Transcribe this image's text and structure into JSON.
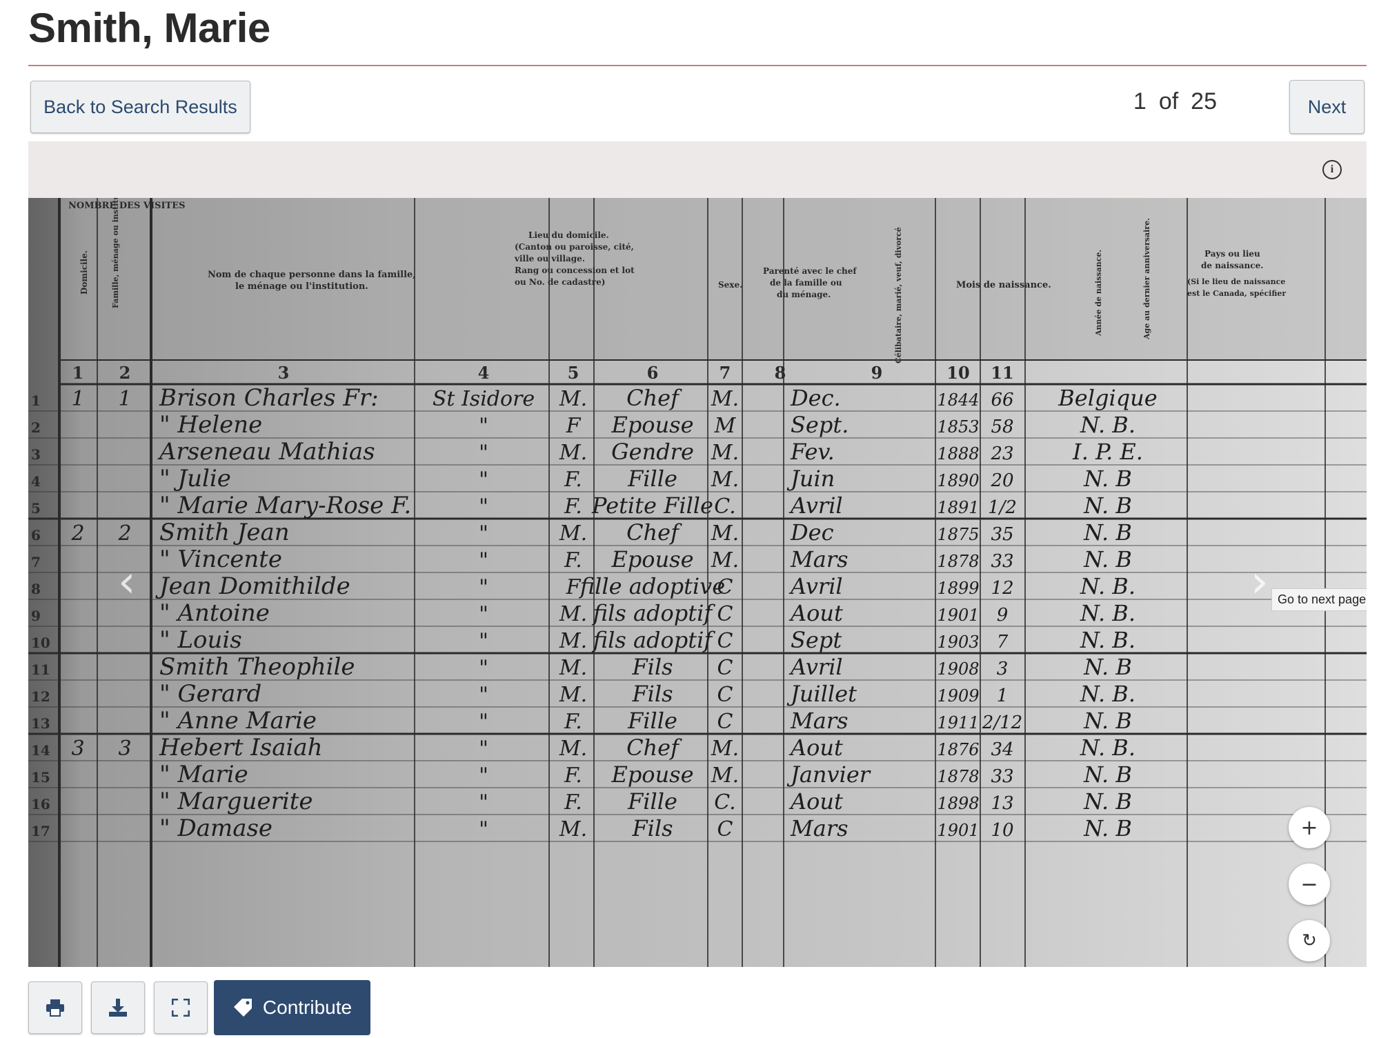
{
  "page": {
    "title": "Smith, Marie"
  },
  "nav": {
    "back_label": "Back to Search Results",
    "current": "1",
    "of_label": "of",
    "total": "25",
    "next_label": "Next"
  },
  "viewer": {
    "tooltip": "Go to next page",
    "zoom_in": "+",
    "zoom_out": "−",
    "reset": "↻",
    "prev_arrow": "‹",
    "next_arrow": "›"
  },
  "toolbar": {
    "contribute_label": "Contribute"
  },
  "icons": [
    "info-icon",
    "print-icon",
    "download-icon",
    "fullscreen-icon",
    "tag-icon",
    "chevron-left-icon",
    "chevron-right-icon",
    "rotate-icon"
  ],
  "census": {
    "column_numbers": [
      "1",
      "2",
      "3",
      "4",
      "5",
      "6",
      "7",
      "8",
      "9",
      "10",
      "11"
    ],
    "rows": [
      {
        "n": "1",
        "dwelling": "1",
        "family": "1",
        "name": "Brison Charles Fr:",
        "place": "St Isidore",
        "sex": "M.",
        "relation": "Chef",
        "marital": "M.",
        "month": "Dec.",
        "year": "1844",
        "age": "66",
        "birthplace": "Belgique"
      },
      {
        "n": "2",
        "dwelling": "",
        "family": "",
        "name": "\" Helene",
        "place": "\"",
        "sex": "F",
        "relation": "Epouse",
        "marital": "M",
        "month": "Sept.",
        "year": "1853",
        "age": "58",
        "birthplace": "N. B."
      },
      {
        "n": "3",
        "dwelling": "",
        "family": "",
        "name": "Arseneau Mathias",
        "place": "\"",
        "sex": "M.",
        "relation": "Gendre",
        "marital": "M.",
        "month": "Fev.",
        "year": "1888",
        "age": "23",
        "birthplace": "I. P. E."
      },
      {
        "n": "4",
        "dwelling": "",
        "family": "",
        "name": "\" Julie",
        "place": "\"",
        "sex": "F.",
        "relation": "Fille",
        "marital": "M.",
        "month": "Juin",
        "year": "1890",
        "age": "20",
        "birthplace": "N. B"
      },
      {
        "n": "5",
        "dwelling": "",
        "family": "",
        "name": "\" Marie Mary-Rose F.",
        "place": "\"",
        "sex": "F.",
        "relation": "Petite Fille",
        "marital": "C.",
        "month": "Avril",
        "year": "1891",
        "age": "1/2",
        "birthplace": "N. B"
      },
      {
        "n": "6",
        "dwelling": "2",
        "family": "2",
        "name": "Smith Jean",
        "place": "\"",
        "sex": "M.",
        "relation": "Chef",
        "marital": "M.",
        "month": "Dec",
        "year": "1875",
        "age": "35",
        "birthplace": "N. B"
      },
      {
        "n": "7",
        "dwelling": "",
        "family": "",
        "name": "\" Vincente",
        "place": "\"",
        "sex": "F.",
        "relation": "Epouse",
        "marital": "M.",
        "month": "Mars",
        "year": "1878",
        "age": "33",
        "birthplace": "N. B"
      },
      {
        "n": "8",
        "dwelling": "",
        "family": "",
        "name": "Jean Domithilde",
        "place": "\"",
        "sex": "F",
        "relation": "fille adoptive",
        "marital": "C",
        "month": "Avril",
        "year": "1899",
        "age": "12",
        "birthplace": "N. B."
      },
      {
        "n": "9",
        "dwelling": "",
        "family": "",
        "name": "\" Antoine",
        "place": "\"",
        "sex": "M.",
        "relation": "fils adoptif",
        "marital": "C",
        "month": "Aout",
        "year": "1901",
        "age": "9",
        "birthplace": "N. B."
      },
      {
        "n": "10",
        "dwelling": "",
        "family": "",
        "name": "\" Louis",
        "place": "\"",
        "sex": "M.",
        "relation": "fils adoptif",
        "marital": "C",
        "month": "Sept",
        "year": "1903",
        "age": "7",
        "birthplace": "N. B."
      },
      {
        "n": "11",
        "dwelling": "",
        "family": "",
        "name": "Smith Theophile",
        "place": "\"",
        "sex": "M.",
        "relation": "Fils",
        "marital": "C",
        "month": "Avril",
        "year": "1908",
        "age": "3",
        "birthplace": "N. B"
      },
      {
        "n": "12",
        "dwelling": "",
        "family": "",
        "name": "\" Gerard",
        "place": "\"",
        "sex": "M.",
        "relation": "Fils",
        "marital": "C",
        "month": "Juillet",
        "year": "1909",
        "age": "1",
        "birthplace": "N. B."
      },
      {
        "n": "13",
        "dwelling": "",
        "family": "",
        "name": "\" Anne Marie",
        "place": "\"",
        "sex": "F.",
        "relation": "Fille",
        "marital": "C",
        "month": "Mars",
        "year": "1911",
        "age": "2/12",
        "birthplace": "N. B"
      },
      {
        "n": "14",
        "dwelling": "3",
        "family": "3",
        "name": "Hebert Isaiah",
        "place": "\"",
        "sex": "M.",
        "relation": "Chef",
        "marital": "M.",
        "month": "Aout",
        "year": "1876",
        "age": "34",
        "birthplace": "N. B."
      },
      {
        "n": "15",
        "dwelling": "",
        "family": "",
        "name": "\" Marie",
        "place": "\"",
        "sex": "F.",
        "relation": "Epouse",
        "marital": "M.",
        "month": "Janvier",
        "year": "1878",
        "age": "33",
        "birthplace": "N. B"
      },
      {
        "n": "16",
        "dwelling": "",
        "family": "",
        "name": "\" Marguerite",
        "place": "\"",
        "sex": "F.",
        "relation": "Fille",
        "marital": "C.",
        "month": "Aout",
        "year": "1898",
        "age": "13",
        "birthplace": "N. B"
      },
      {
        "n": "17",
        "dwelling": "",
        "family": "",
        "name": "\" Damase",
        "place": "\"",
        "sex": "M.",
        "relation": "Fils",
        "marital": "C",
        "month": "Mars",
        "year": "1901",
        "age": "10",
        "birthplace": "N. B"
      }
    ]
  }
}
